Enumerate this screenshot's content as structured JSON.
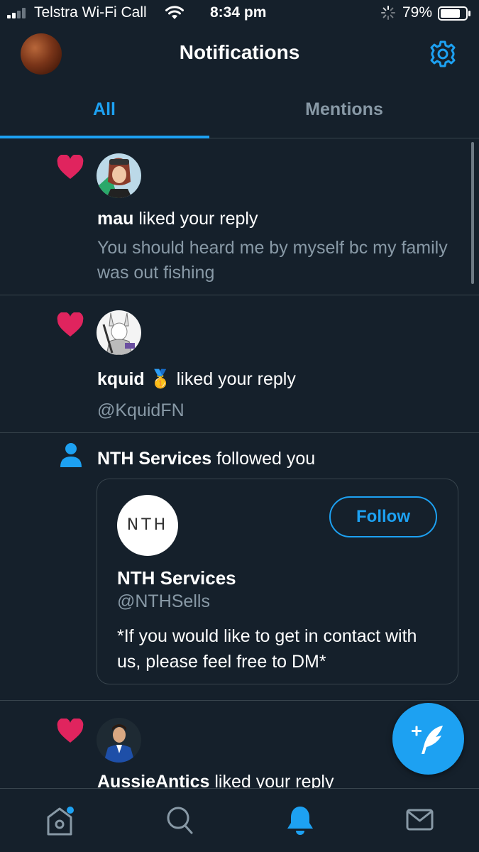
{
  "status_bar": {
    "carrier": "Telstra Wi-Fi Call",
    "time": "8:34 pm",
    "battery": "79%"
  },
  "header": {
    "title": "Notifications"
  },
  "tabs": [
    {
      "label": "All",
      "selected": true
    },
    {
      "label": "Mentions",
      "selected": false
    }
  ],
  "notifications": [
    {
      "type": "like",
      "user": "mau",
      "action": "liked your reply",
      "text": "You should heard me by myself bc my family was out fishing"
    },
    {
      "type": "like",
      "user": "kquid",
      "badge": "🥇",
      "action": "liked your reply",
      "text": "@KquidFN"
    },
    {
      "type": "follow",
      "user": "NTH Services",
      "action": "followed you",
      "card": {
        "logo_text": "NTH",
        "follow_label": "Follow",
        "name": "NTH Services",
        "handle": "@NTHSells",
        "bio": "*If you would like to get in contact with us, please feel free to DM*"
      }
    },
    {
      "type": "like",
      "user": "AussieAntics",
      "action": "liked your reply"
    }
  ],
  "colors": {
    "background": "#15202b",
    "accent": "#1da1f2",
    "heart": "#e0245e",
    "secondary_text": "#8899a6",
    "divider": "#38444d"
  },
  "icons": {
    "signal": "signal-bars-icon",
    "wifi": "wifi-icon",
    "activity": "activity-spinner-icon",
    "battery": "battery-icon",
    "settings": "gear-icon",
    "like": "heart-icon",
    "follow": "person-icon",
    "compose": "compose-feather-icon",
    "home": "home-icon",
    "search": "search-icon",
    "notifications": "bell-icon",
    "messages": "mail-icon"
  }
}
